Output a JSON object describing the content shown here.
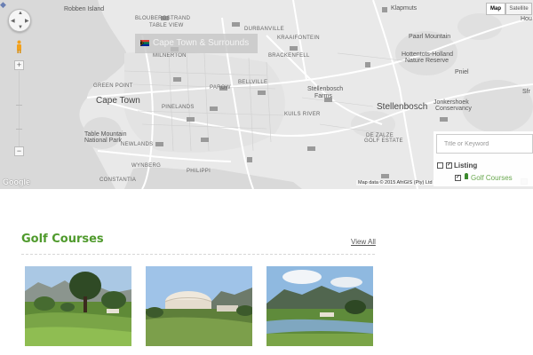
{
  "map": {
    "region_label": "Cape Town & Surrounds",
    "type_map": "Map",
    "type_satellite": "Satellite",
    "attribution": "Map data © 2015 AfriGIS (Pty) Ltd",
    "logo_text": "Google",
    "labels": {
      "robben_island": "Robben Island",
      "blouberg": "BLOUBERGSTRAND",
      "table_view": "TABLE VIEW",
      "milnerton": "MILNERTON",
      "durbanville": "DURBANVILLE",
      "kraaifontein": "KRAAIFONTEIN",
      "brackenfell": "BRACKENFELL",
      "klapmuts": "Klapmuts",
      "hottentots": "Hottentots-Holland",
      "paarl_mountain": "Paarl Mountain",
      "nature_reserve": "Nature Reserve",
      "green_point": "GREEN POINT",
      "cape_town": "Cape Town",
      "pinelands": "PINELANDS",
      "parow": "PAROW",
      "bellville": "BELLVILLE",
      "table_mountain": "Table Mountain",
      "national_park": "National Park",
      "newlands": "NEWLANDS",
      "kuils_river": "KUILS RIVER",
      "stellenbosch_farms": "Stellenbosch",
      "farms": "Farms",
      "stellenbosch": "Stellenbosch",
      "jonkershoek": "Jonkershoek",
      "conservancy": "Conservancy",
      "de_zalze": "DE ZALZE",
      "golf_estate": "GOLF ESTATE",
      "wynberg": "WYNBERG",
      "philippi": "PHILIPPI",
      "constantia": "CONSTANTIA",
      "pniel": "Pniel",
      "hout": "Hou",
      "sfr": "Sfr"
    }
  },
  "filter": {
    "search_placeholder": "Title or Keyword",
    "listing_label": "Listing",
    "golf_label": "Golf Courses"
  },
  "section": {
    "title": "Golf Courses",
    "view_all": "View All"
  },
  "colors": {
    "accent_green": "#4f9a2c",
    "map_bg": "#e9e9e9"
  }
}
